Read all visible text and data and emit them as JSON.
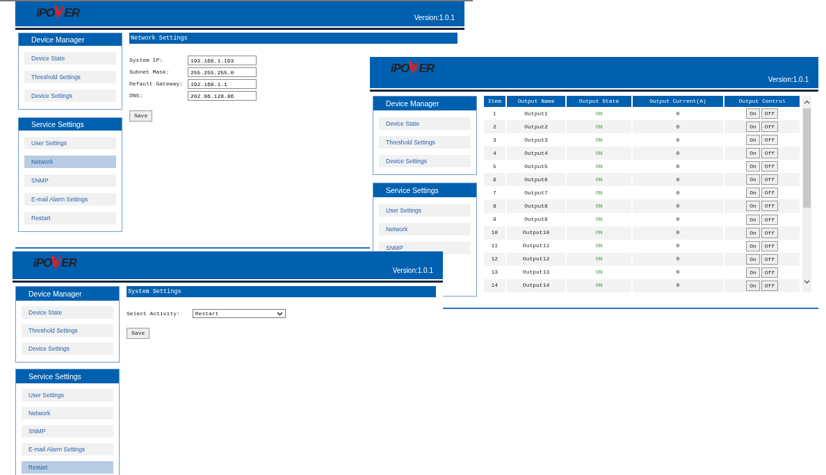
{
  "screens": [
    {
      "logo": [
        "iPO",
        "ER"
      ],
      "version": "Version:1.0.1",
      "sidebar": [
        {
          "title": "Device Manager",
          "items": [
            {
              "label": "Device State",
              "selected": false
            },
            {
              "label": "Threshold Settings",
              "selected": false
            },
            {
              "label": "Device Settings",
              "selected": false
            }
          ]
        },
        {
          "title": "Service Settings",
          "items": [
            {
              "label": "User Settings",
              "selected": false
            },
            {
              "label": "Network",
              "selected": true
            },
            {
              "label": "SNMP",
              "selected": false
            },
            {
              "label": "E-mail Alarm Settings",
              "selected": false
            },
            {
              "label": "Restart",
              "selected": false
            }
          ]
        }
      ],
      "content": {
        "kind": "form",
        "title": "Network Settings",
        "fields": [
          {
            "label": "System IP:",
            "value": "192.168.1.163"
          },
          {
            "label": "Subnet Mask:",
            "value": "255.255.255.0"
          },
          {
            "label": "Default Gateway:",
            "value": "192.168.1.1"
          },
          {
            "label": "DNS:",
            "value": "202.96.128.86"
          }
        ],
        "save": "Save"
      }
    },
    {
      "logo": [
        "iPO",
        "ER"
      ],
      "version": "Version:1.0.1",
      "sidebar": [
        {
          "title": "Device Manager",
          "items": [
            {
              "label": "Device State",
              "selected": false
            },
            {
              "label": "Threshold Settings",
              "selected": false
            },
            {
              "label": "Device Settings",
              "selected": false
            }
          ]
        },
        {
          "title": "Service Settings",
          "items": [
            {
              "label": "User Settings",
              "selected": false
            },
            {
              "label": "Network",
              "selected": false
            },
            {
              "label": "SNMP",
              "selected": false
            }
          ]
        }
      ],
      "content": {
        "kind": "table",
        "columns": [
          "Item",
          "Output Name",
          "Output State",
          "Output Current(A)",
          "Output Control"
        ],
        "rows": [
          {
            "item": "1",
            "name": "Output1",
            "state": "ON",
            "current": "0",
            "on": "On",
            "off": "Off"
          },
          {
            "item": "2",
            "name": "Output2",
            "state": "ON",
            "current": "0",
            "on": "On",
            "off": "Off"
          },
          {
            "item": "3",
            "name": "Output3",
            "state": "ON",
            "current": "0",
            "on": "On",
            "off": "Off"
          },
          {
            "item": "4",
            "name": "Output4",
            "state": "ON",
            "current": "0",
            "on": "On",
            "off": "Off"
          },
          {
            "item": "5",
            "name": "Output5",
            "state": "ON",
            "current": "0",
            "on": "On",
            "off": "Off"
          },
          {
            "item": "6",
            "name": "Output6",
            "state": "ON",
            "current": "0",
            "on": "On",
            "off": "Off"
          },
          {
            "item": "7",
            "name": "Output7",
            "state": "ON",
            "current": "0",
            "on": "On",
            "off": "Off"
          },
          {
            "item": "8",
            "name": "Output8",
            "state": "ON",
            "current": "0",
            "on": "On",
            "off": "Off"
          },
          {
            "item": "9",
            "name": "Output9",
            "state": "ON",
            "current": "0",
            "on": "On",
            "off": "Off"
          },
          {
            "item": "10",
            "name": "Output10",
            "state": "ON",
            "current": "0",
            "on": "On",
            "off": "Off"
          },
          {
            "item": "11",
            "name": "Output11",
            "state": "ON",
            "current": "0",
            "on": "On",
            "off": "Off"
          },
          {
            "item": "12",
            "name": "Output12",
            "state": "ON",
            "current": "0",
            "on": "On",
            "off": "Off"
          },
          {
            "item": "13",
            "name": "Output13",
            "state": "ON",
            "current": "0",
            "on": "On",
            "off": "Off"
          },
          {
            "item": "14",
            "name": "Output14",
            "state": "ON",
            "current": "0",
            "on": "On",
            "off": "Off"
          }
        ]
      }
    },
    {
      "logo": [
        "iPO",
        "ER"
      ],
      "version": "Version:1.0.1",
      "sidebar": [
        {
          "title": "Device Manager",
          "items": [
            {
              "label": "Device State",
              "selected": false
            },
            {
              "label": "Threshold Settings",
              "selected": false
            },
            {
              "label": "Device Settings",
              "selected": false
            }
          ]
        },
        {
          "title": "Service Settings",
          "items": [
            {
              "label": "User Settings",
              "selected": false
            },
            {
              "label": "Network",
              "selected": false
            },
            {
              "label": "SNMP",
              "selected": false
            },
            {
              "label": "E-mail Alarm Settings",
              "selected": false
            },
            {
              "label": "Restart",
              "selected": true
            }
          ]
        }
      ],
      "content": {
        "kind": "select",
        "title": "System Settings",
        "label": "Select Activity:",
        "value": "Restart",
        "save": "Save"
      }
    }
  ]
}
